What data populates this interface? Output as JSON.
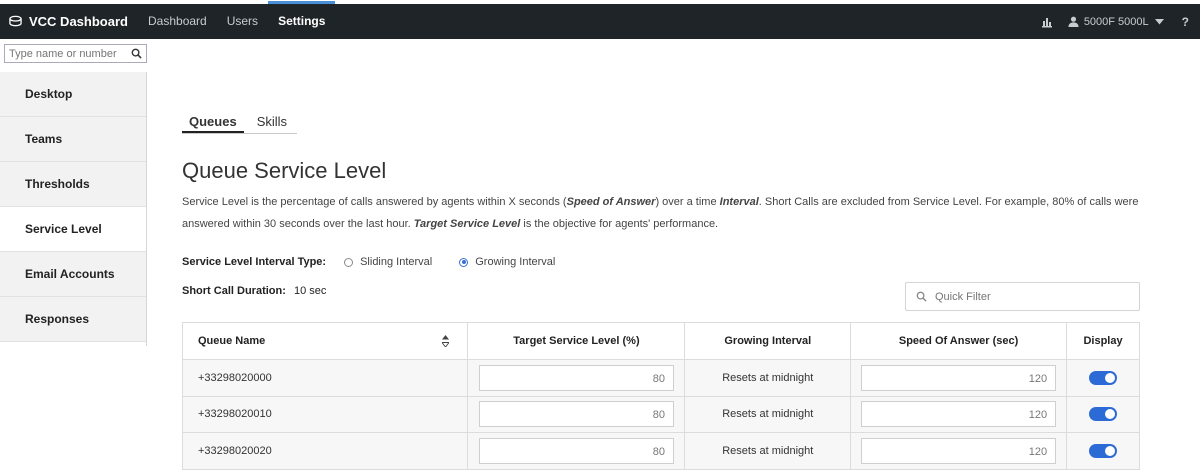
{
  "app": {
    "title": "VCC Dashboard"
  },
  "nav": {
    "items": [
      {
        "label": "Dashboard"
      },
      {
        "label": "Users"
      },
      {
        "label": "Settings"
      }
    ]
  },
  "topbar": {
    "user_name": "5000F 5000L",
    "help": "?"
  },
  "search": {
    "placeholder": "Type name or number"
  },
  "sidebar": {
    "items": [
      {
        "label": "Desktop"
      },
      {
        "label": "Teams"
      },
      {
        "label": "Thresholds"
      },
      {
        "label": "Service Level"
      },
      {
        "label": "Email Accounts"
      },
      {
        "label": "Responses"
      }
    ]
  },
  "tabs": [
    {
      "label": "Queues"
    },
    {
      "label": "Skills"
    }
  ],
  "page": {
    "title": "Queue Service Level",
    "desc": {
      "p1": "Service Level is the percentage of calls answered by agents within X seconds (",
      "em1": "Speed of Answer",
      "p2": ") over a time ",
      "em2": "Interval",
      "p3": ". Short Calls are excluded from Service Level. For example, 80% of calls were answered within 30 seconds over the last hour. ",
      "em3": "Target Service Level",
      "p4": " is the objective for agents' performance."
    }
  },
  "interval": {
    "label": "Service Level Interval Type:",
    "options": [
      {
        "label": "Sliding Interval",
        "selected": false
      },
      {
        "label": "Growing Interval",
        "selected": true
      }
    ]
  },
  "short_call": {
    "label": "Short Call Duration:",
    "value": "10 sec"
  },
  "quick_filter": {
    "placeholder": "Quick Filter"
  },
  "table": {
    "headers": {
      "queue_name": "Queue Name",
      "target": "Target Service Level (%)",
      "growing": "Growing Interval",
      "speed": "Speed Of Answer (sec)",
      "display": "Display"
    },
    "rows": [
      {
        "queue": "+33298020000",
        "target": "80",
        "growing": "Resets at midnight",
        "speed": "120",
        "display": true
      },
      {
        "queue": "+33298020010",
        "target": "80",
        "growing": "Resets at midnight",
        "speed": "120",
        "display": true
      },
      {
        "queue": "+33298020020",
        "target": "80",
        "growing": "Resets at midnight",
        "speed": "120",
        "display": true
      }
    ]
  },
  "colors": {
    "topbar_bg": "#1f2428",
    "accent": "#2c6ad6"
  },
  "icons": [
    "dashboard-logo-icon",
    "chart-icon",
    "user-icon",
    "caret-down-icon",
    "search-icon",
    "sort-icon"
  ]
}
